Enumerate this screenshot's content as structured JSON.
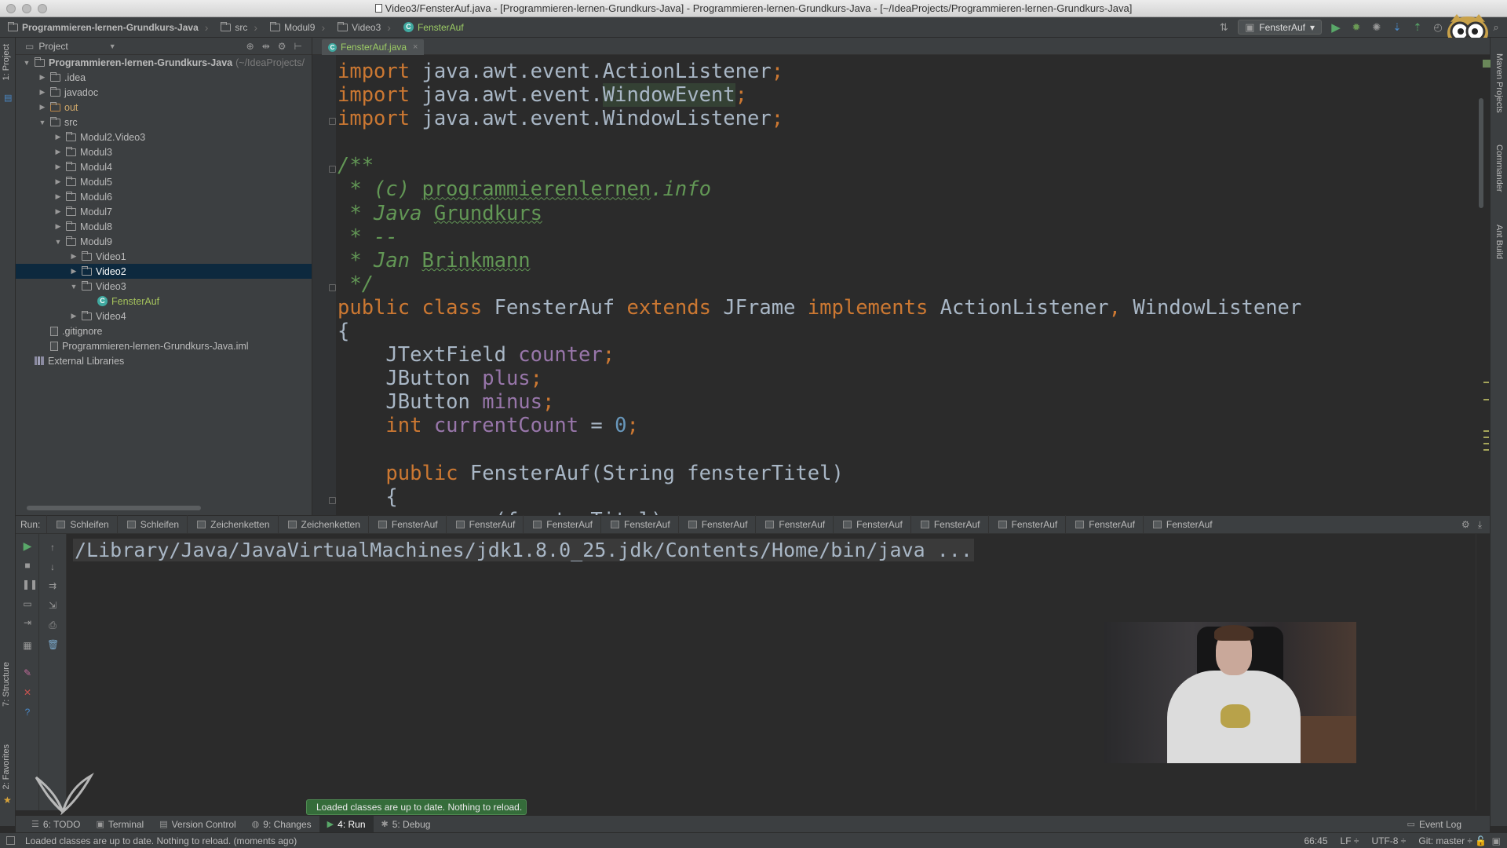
{
  "window": {
    "title": "Video3/FensterAuf.java - [Programmieren-lernen-Grundkurs-Java] - Programmieren-lernen-Grundkurs-Java - [~/IdeaProjects/Programmieren-lernen-Grundkurs-Java]"
  },
  "breadcrumbs": [
    "Programmieren-lernen-Grundkurs-Java",
    "src",
    "Modul9",
    "Video3",
    "FensterAuf"
  ],
  "toolbar": {
    "run_config": "FensterAuf",
    "run_config_arrow": "▾"
  },
  "left_strip": {
    "project_tab": "1: Project",
    "structure_tab": "7: Structure",
    "favorites_tab": "2: Favorites"
  },
  "right_strip": {
    "maven_tab": "Maven Projects",
    "commander_tab": "Commander",
    "ant_tab": "Ant Build"
  },
  "project_panel": {
    "header": "Project",
    "tree": [
      {
        "label": "Programmieren-lernen-Grundkurs-Java",
        "hint": "(~/IdeaProjects/",
        "depth": 0,
        "arrow": "▼",
        "kind": "folder",
        "bold": true
      },
      {
        "label": ".idea",
        "depth": 1,
        "arrow": "▶",
        "kind": "folder"
      },
      {
        "label": "javadoc",
        "depth": 1,
        "arrow": "▶",
        "kind": "folder"
      },
      {
        "label": "out",
        "depth": 1,
        "arrow": "▶",
        "kind": "folder",
        "color": "orange"
      },
      {
        "label": "src",
        "depth": 1,
        "arrow": "▼",
        "kind": "folder"
      },
      {
        "label": "Modul2.Video3",
        "depth": 2,
        "arrow": "▶",
        "kind": "folder"
      },
      {
        "label": "Modul3",
        "depth": 2,
        "arrow": "▶",
        "kind": "folder"
      },
      {
        "label": "Modul4",
        "depth": 2,
        "arrow": "▶",
        "kind": "folder"
      },
      {
        "label": "Modul5",
        "depth": 2,
        "arrow": "▶",
        "kind": "folder"
      },
      {
        "label": "Modul6",
        "depth": 2,
        "arrow": "▶",
        "kind": "folder"
      },
      {
        "label": "Modul7",
        "depth": 2,
        "arrow": "▶",
        "kind": "folder"
      },
      {
        "label": "Modul8",
        "depth": 2,
        "arrow": "▶",
        "kind": "folder"
      },
      {
        "label": "Modul9",
        "depth": 2,
        "arrow": "▼",
        "kind": "folder"
      },
      {
        "label": "Video1",
        "depth": 3,
        "arrow": "▶",
        "kind": "folder"
      },
      {
        "label": "Video2",
        "depth": 3,
        "arrow": "▶",
        "kind": "folder",
        "selected": true
      },
      {
        "label": "Video3",
        "depth": 3,
        "arrow": "▼",
        "kind": "folder"
      },
      {
        "label": "FensterAuf",
        "depth": 4,
        "arrow": "",
        "kind": "class",
        "color": "green"
      },
      {
        "label": "Video4",
        "depth": 3,
        "arrow": "▶",
        "kind": "folder"
      },
      {
        "label": ".gitignore",
        "depth": 1,
        "arrow": "",
        "kind": "file"
      },
      {
        "label": "Programmieren-lernen-Grundkurs-Java.iml",
        "depth": 1,
        "arrow": "",
        "kind": "file"
      },
      {
        "label": "External Libraries",
        "depth": 0,
        "arrow": "",
        "kind": "library"
      }
    ]
  },
  "editor": {
    "tab_label": "FensterAuf.java",
    "tab_close": "×",
    "code_lines": [
      [
        [
          "kw",
          "import "
        ],
        [
          "pl",
          "java.awt.event.ActionListener"
        ],
        [
          "kw",
          ";"
        ]
      ],
      [
        [
          "kw",
          "import "
        ],
        [
          "pl",
          "java.awt.event."
        ],
        [
          "wf",
          "WindowEvent"
        ],
        [
          "kw",
          ";"
        ]
      ],
      [
        [
          "kw",
          "import "
        ],
        [
          "pl",
          "java.awt.event.WindowListener"
        ],
        [
          "kw",
          ";"
        ]
      ],
      [],
      [
        [
          "doc",
          "/**"
        ]
      ],
      [
        [
          "doc",
          " * (c) "
        ],
        [
          "doc-u",
          "programmierenlernen"
        ],
        [
          "doc",
          ".info"
        ]
      ],
      [
        [
          "doc",
          " * Java "
        ],
        [
          "doc-u",
          "Grundkurs"
        ]
      ],
      [
        [
          "doc",
          " * --"
        ]
      ],
      [
        [
          "doc",
          " * Jan "
        ],
        [
          "doc-u",
          "Brinkmann"
        ]
      ],
      [
        [
          "doc",
          " */"
        ]
      ],
      [
        [
          "kw",
          "public class "
        ],
        [
          "pl",
          "FensterAuf "
        ],
        [
          "kw",
          "extends "
        ],
        [
          "pl",
          "JFrame "
        ],
        [
          "kw",
          "implements "
        ],
        [
          "pl",
          "ActionListener"
        ],
        [
          "kw",
          ", "
        ],
        [
          "pl",
          "WindowListener"
        ]
      ],
      [
        [
          "pl",
          "{"
        ]
      ],
      [
        [
          "pl",
          "    JTextField "
        ],
        [
          "fld",
          "counter"
        ],
        [
          "kw",
          ";"
        ]
      ],
      [
        [
          "pl",
          "    JButton "
        ],
        [
          "fld",
          "plus"
        ],
        [
          "kw",
          ";"
        ]
      ],
      [
        [
          "pl",
          "    JButton "
        ],
        [
          "fld",
          "minus"
        ],
        [
          "kw",
          ";"
        ]
      ],
      [
        [
          "kw",
          "    int "
        ],
        [
          "fld",
          "currentCount "
        ],
        [
          "pl",
          "= "
        ],
        [
          "num",
          "0"
        ],
        [
          "kw",
          ";"
        ]
      ],
      [],
      [
        [
          "kw",
          "    public "
        ],
        [
          "pl",
          "FensterAuf(String fensterTitel)"
        ]
      ],
      [
        [
          "pl",
          "    {"
        ]
      ],
      [
        [
          "pl",
          "        super(fensterTitel)"
        ]
      ]
    ]
  },
  "run_panel": {
    "label": "Run:",
    "tabs": [
      "Schleifen",
      "Schleifen",
      "Zeichenketten",
      "Zeichenketten",
      "FensterAuf",
      "FensterAuf",
      "FensterAuf",
      "FensterAuf",
      "FensterAuf",
      "FensterAuf",
      "FensterAuf",
      "FensterAuf",
      "FensterAuf",
      "FensterAuf",
      "FensterAuf"
    ],
    "console_text": "/Library/Java/JavaVirtualMachines/jdk1.8.0_25.jdk/Contents/Home/bin/java ..."
  },
  "notification": {
    "text": "Loaded classes are up to date. Nothing to reload."
  },
  "tool_windows": [
    {
      "label": "6: TODO",
      "icon": "☰"
    },
    {
      "label": "Terminal",
      "icon": "▣"
    },
    {
      "label": "Version Control",
      "icon": "▤"
    },
    {
      "label": "9: Changes",
      "icon": "◍"
    },
    {
      "label": "4: Run",
      "icon": "▶",
      "active": true
    },
    {
      "label": "5: Debug",
      "icon": "✱"
    }
  ],
  "event_log": "Event Log",
  "status_bar": {
    "message": "Loaded classes are up to date. Nothing to reload. (moments ago)",
    "position": "66:45",
    "line_sep": "LF ÷",
    "encoding": "UTF-8 ÷",
    "vcs": "Git: master ÷"
  },
  "colors": {
    "keyword": "#cc7832",
    "field": "#9876aa",
    "number": "#6897bb",
    "doc_comment": "#629755",
    "plain": "#a9b7c6",
    "background": "#2b2b2b",
    "panel": "#3c3f41",
    "selection": "#0d293e"
  }
}
